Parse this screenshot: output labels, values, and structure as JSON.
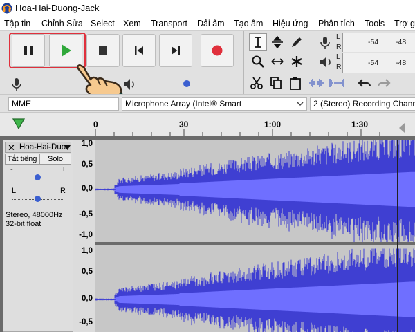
{
  "window": {
    "title": "Hoa-Hai-Duong-Jack"
  },
  "menu": [
    "Tập tin",
    "Chỉnh Sửa",
    "Select",
    "Xem",
    "Transport",
    "Dải âm",
    "Tạo âm",
    "Hiệu ứng",
    "Phân tích",
    "Tools",
    "Trợ g"
  ],
  "transport": {
    "pause_icon": "pause-icon",
    "play_icon": "play-icon",
    "stop_icon": "stop-icon",
    "skip_start_icon": "skip-start-icon",
    "skip_end_icon": "skip-end-icon",
    "record_icon": "record-icon",
    "highlight_color": "#e0303c",
    "record_color": "#e0303c"
  },
  "meters": {
    "record": {
      "L": "L",
      "R": "R",
      "scale": [
        "-54",
        "-48"
      ]
    },
    "playback": {
      "L": "L",
      "R": "R",
      "scale": [
        "-54",
        "-48"
      ]
    }
  },
  "sliders": {
    "mic_volume_fraction": 0.82,
    "speaker_volume_fraction": 0.5
  },
  "devices": {
    "host": "MME",
    "mic": "Microphone Array (Intel® Smart",
    "channels": "2 (Stereo) Recording Chann"
  },
  "timeline": {
    "ticks": [
      "0",
      "30",
      "1:00",
      "1:30"
    ]
  },
  "track": {
    "name": "Hoa-Hai-Duo",
    "mute": "Tắt tiếng",
    "solo": "Solo",
    "gain_minus": "-",
    "gain_plus": "+",
    "pan_L": "L",
    "pan_R": "R",
    "info_line1": "Stereo, 48000Hz",
    "info_line2": "32-bit float",
    "gain_fraction": 0.5,
    "pan_fraction": 0.5
  },
  "amplitude_labels": {
    "top": [
      "1,0",
      "0,5",
      "0,0",
      "-0,5",
      "-1,0"
    ],
    "bottom": [
      "1,0",
      "0,5",
      "0,0",
      "-0,5"
    ]
  },
  "waveform_color": "#3f3fd2",
  "waveform_rms_color": "#6f6fff"
}
